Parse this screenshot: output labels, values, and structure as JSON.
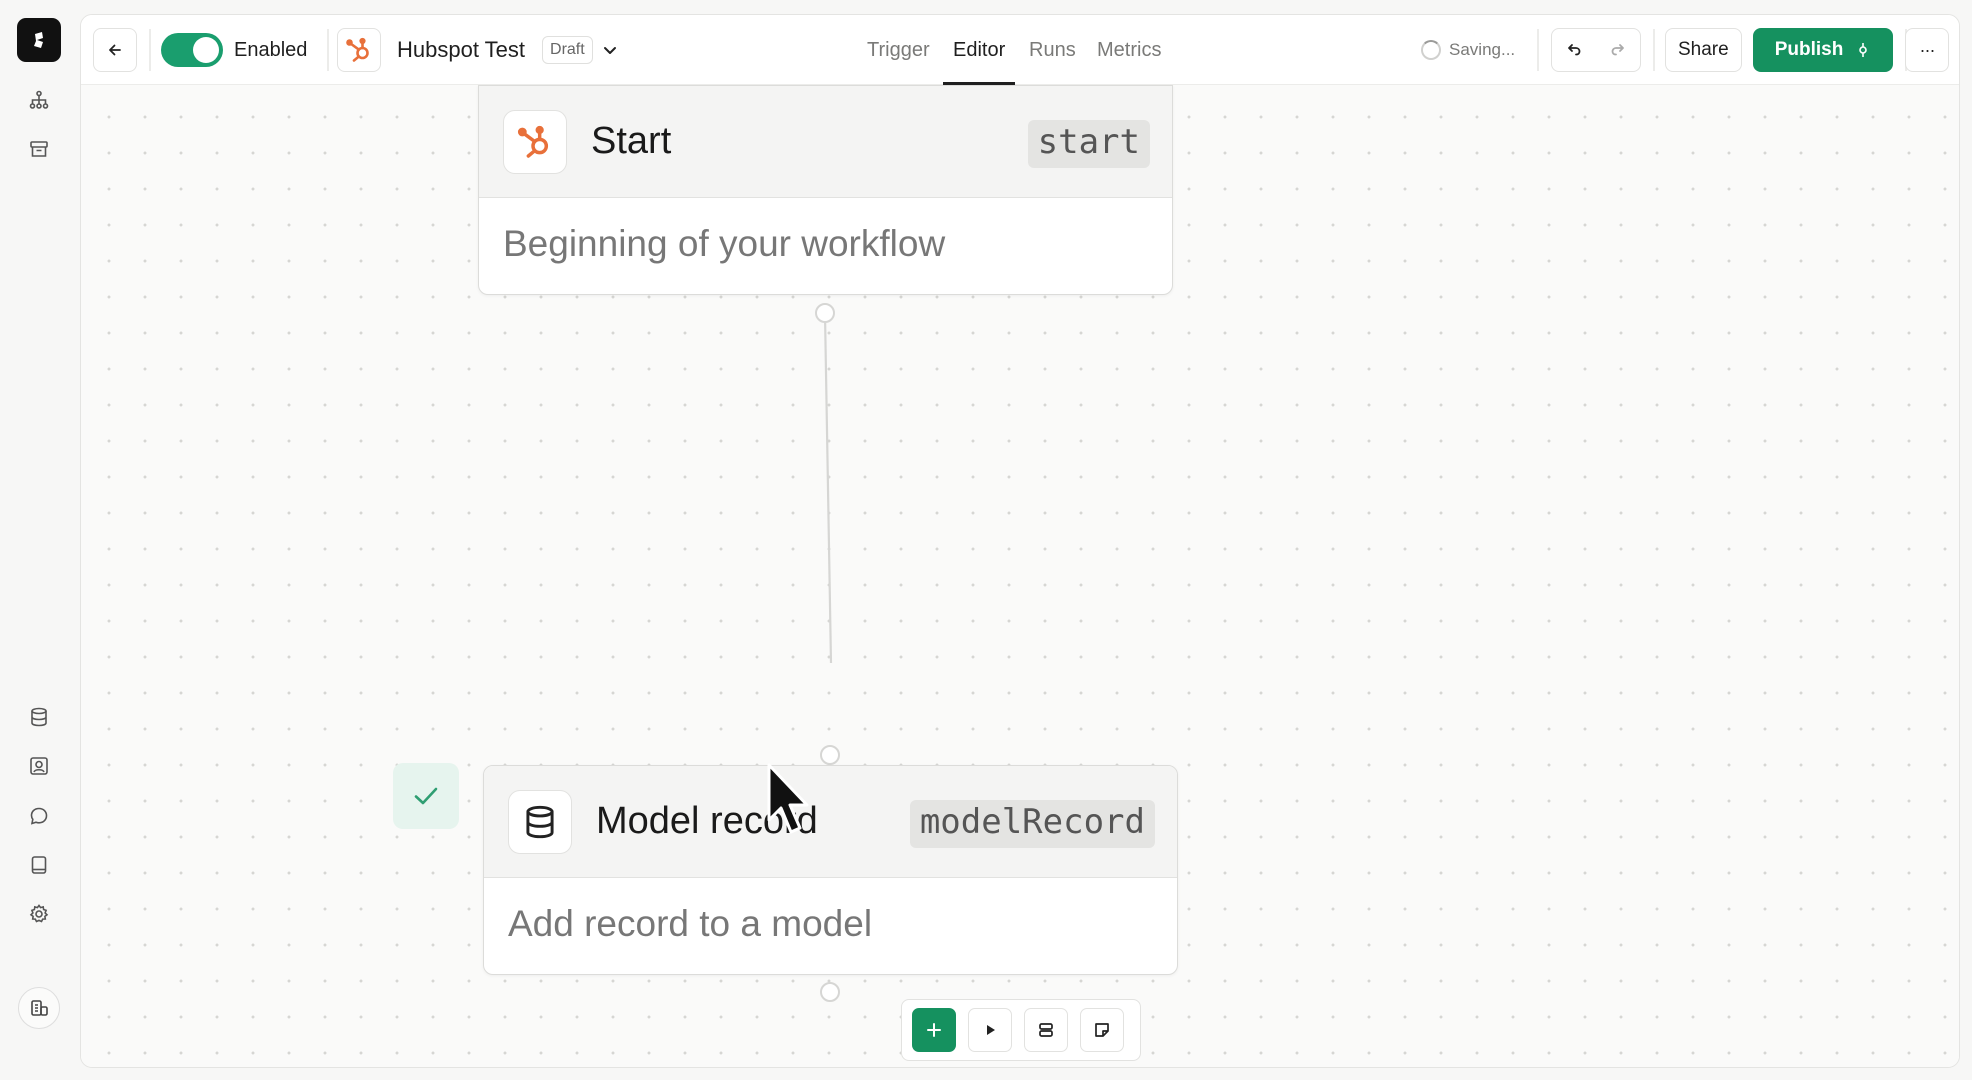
{
  "header": {
    "enabled_label": "Enabled",
    "workflow_title": "Hubspot Test",
    "status_badge": "Draft",
    "tabs": [
      {
        "label": "Trigger",
        "active": false
      },
      {
        "label": "Editor",
        "active": true
      },
      {
        "label": "Runs",
        "active": false
      },
      {
        "label": "Metrics",
        "active": false
      }
    ],
    "saving_text": "Saving...",
    "share_label": "Share",
    "publish_label": "Publish",
    "more_label": "···"
  },
  "nodes": {
    "start": {
      "title": "Start",
      "key": "start",
      "description": "Beginning of your workflow",
      "icon": "hubspot-icon"
    },
    "model_record": {
      "title": "Model record",
      "key": "modelRecord",
      "description": "Add record to a model",
      "icon": "database-icon"
    }
  },
  "colors": {
    "accent_green": "#15915f",
    "toggle_green": "#1a9e6e",
    "hubspot_orange": "#e8703a",
    "check_bg": "#e6f4ee"
  },
  "sidebar": {
    "items": [
      "workflows-icon",
      "archive-icon",
      "database-icon",
      "contacts-icon",
      "chat-icon",
      "docs-icon",
      "settings-icon",
      "org-switcher-icon"
    ]
  }
}
